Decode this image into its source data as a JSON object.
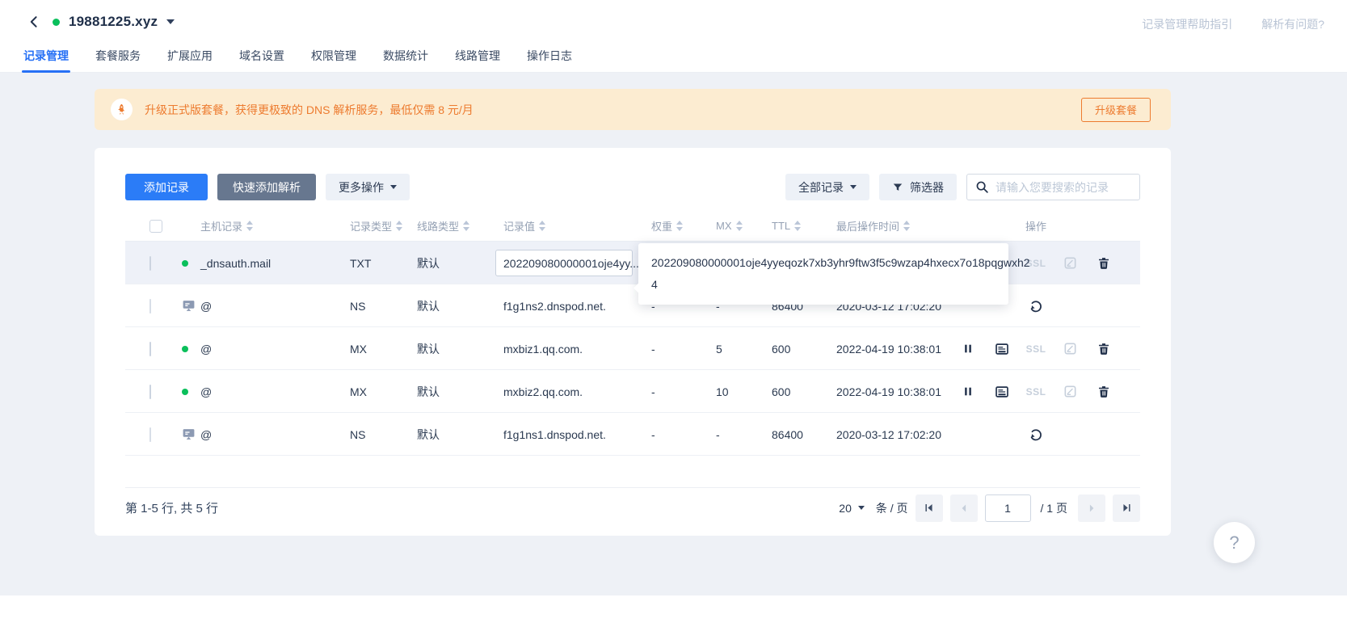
{
  "header": {
    "domain": "19881225.xyz",
    "tabs": [
      {
        "label": "记录管理"
      },
      {
        "label": "套餐服务"
      },
      {
        "label": "扩展应用"
      },
      {
        "label": "域名设置"
      },
      {
        "label": "权限管理"
      },
      {
        "label": "数据统计"
      },
      {
        "label": "线路管理"
      },
      {
        "label": "操作日志"
      }
    ],
    "links": {
      "help": "记录管理帮助指引",
      "issue": "解析有问题?"
    }
  },
  "banner": {
    "text": "升级正式版套餐，获得更极致的 DNS 解析服务，最低仅需 8 元/月",
    "button": "升级套餐"
  },
  "toolbar": {
    "add": "添加记录",
    "quick_add": "快速添加解析",
    "more": "更多操作",
    "filter_all": "全部记录",
    "filter": "筛选器",
    "search_placeholder": "请输入您要搜索的记录"
  },
  "table": {
    "headers": {
      "host": "主机记录",
      "type": "记录类型",
      "line": "线路类型",
      "value": "记录值",
      "weight": "权重",
      "mx": "MX",
      "ttl": "TTL",
      "time": "最后操作时间",
      "ops": "操作"
    },
    "ssl_label": "SSL",
    "rows": [
      {
        "host": "_dnsauth.mail",
        "type": "TXT",
        "line": "默认",
        "value": "202209080000001oje4yy...",
        "weight": "",
        "mx": "",
        "ttl": "",
        "time": ""
      },
      {
        "host": "@",
        "type": "NS",
        "line": "默认",
        "value": "f1g1ns2.dnspod.net.",
        "weight": "-",
        "mx": "-",
        "ttl": "86400",
        "time": "2020-03-12 17:02:20"
      },
      {
        "host": "@",
        "type": "MX",
        "line": "默认",
        "value": "mxbiz1.qq.com.",
        "weight": "-",
        "mx": "5",
        "ttl": "600",
        "time": "2022-04-19 10:38:01"
      },
      {
        "host": "@",
        "type": "MX",
        "line": "默认",
        "value": "mxbiz2.qq.com.",
        "weight": "-",
        "mx": "10",
        "ttl": "600",
        "time": "2022-04-19 10:38:01"
      },
      {
        "host": "@",
        "type": "NS",
        "line": "默认",
        "value": "f1g1ns1.dnspod.net.",
        "weight": "-",
        "mx": "-",
        "ttl": "86400",
        "time": "2020-03-12 17:02:20"
      }
    ]
  },
  "tooltip": {
    "line1": "202209080000001oje4yyeqozk7xb3yhr9ftw3f5c9wzap4hxecx7o18pqgwxh2",
    "line2": "4"
  },
  "pagination": {
    "summary": "第 1-5 行, 共 5 行",
    "page_size": "20",
    "per_page_label": "条 / 页",
    "current_page": "1",
    "total_label": "/ 1 页"
  },
  "fab": {
    "label": "?"
  }
}
